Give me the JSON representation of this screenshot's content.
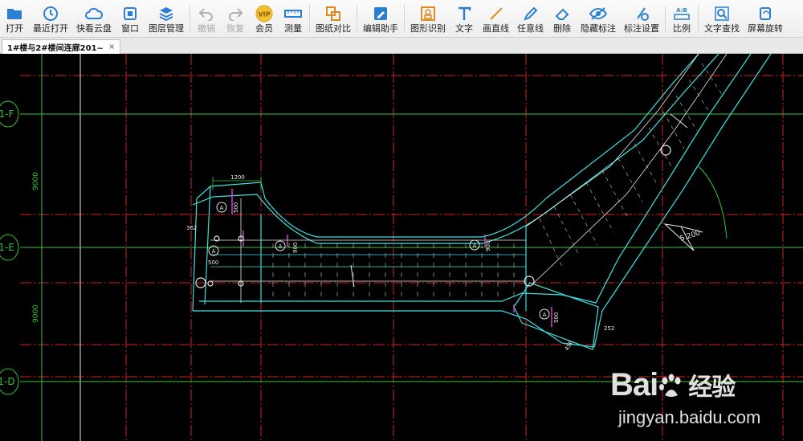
{
  "toolbar": {
    "buttons": [
      {
        "id": "open",
        "label": "打开",
        "icon": "folder-icon"
      },
      {
        "id": "recent",
        "label": "最近打开",
        "icon": "clock-icon"
      },
      {
        "id": "cloud",
        "label": "快看云盘",
        "icon": "cloud-icon"
      },
      {
        "id": "window",
        "label": "窗口",
        "icon": "window-icon"
      },
      {
        "id": "layers",
        "label": "图层管理",
        "icon": "layers-icon"
      },
      {
        "id": "undo",
        "label": "撤销",
        "icon": "undo-icon",
        "disabled": true
      },
      {
        "id": "redo",
        "label": "恢复",
        "icon": "redo-icon",
        "disabled": true
      },
      {
        "id": "vip",
        "label": "会员",
        "icon": "vip-badge-icon",
        "badge": "VIP"
      },
      {
        "id": "measure",
        "label": "测量",
        "icon": "ruler-icon"
      },
      {
        "id": "compare",
        "label": "图纸对比",
        "icon": "compare-icon"
      },
      {
        "id": "edit-assist",
        "label": "编辑助手",
        "icon": "edit-assist-icon"
      },
      {
        "id": "shape-recog",
        "label": "图形识别",
        "icon": "shape-recognition-icon"
      },
      {
        "id": "text",
        "label": "文字",
        "icon": "text-icon"
      },
      {
        "id": "line",
        "label": "画直线",
        "icon": "line-icon"
      },
      {
        "id": "freeline",
        "label": "任意线",
        "icon": "pen-icon"
      },
      {
        "id": "delete",
        "label": "删除",
        "icon": "eraser-icon"
      },
      {
        "id": "hide-mark",
        "label": "隐藏标注",
        "icon": "eye-hide-icon"
      },
      {
        "id": "mark-settings",
        "label": "标注设置",
        "icon": "mark-settings-icon"
      },
      {
        "id": "scale",
        "label": "比例",
        "icon": "scale-icon",
        "badge": "A:B"
      },
      {
        "id": "text-search",
        "label": "文字查找",
        "icon": "text-search-icon"
      },
      {
        "id": "screen-rotate",
        "label": "屏幕旋转",
        "icon": "screen-rotate-icon"
      }
    ],
    "colors": {
      "accent": "#2a7fd4",
      "vip": "#e0a020",
      "gold": "#d9a21b"
    }
  },
  "tab": {
    "title": "1#楼与2#楼间连廊201~",
    "close": "×"
  },
  "drawing": {
    "axes": {
      "top": "1-F",
      "middle": "1-E",
      "bottom": "1-D"
    },
    "dims": {
      "left_upper": "9000",
      "left_lower": "9000",
      "top_width": "1200",
      "d1": "500",
      "d2": "362",
      "d3": "500",
      "d4": "900",
      "d5": "900",
      "d6": "500",
      "d7": "252",
      "d8": "456"
    },
    "annotation": "5.200",
    "section_marks": [
      "A",
      "A",
      "A",
      "A",
      "A"
    ],
    "colors": {
      "grid": "#d42020",
      "axis": "#35c435",
      "outline": "#40e0e0",
      "white": "#e8e8e8",
      "magenta": "#d040d0"
    }
  },
  "watermark": {
    "logo": "Bai",
    "logo_suffix": "经验",
    "url": "jingyan.baidu.com"
  }
}
